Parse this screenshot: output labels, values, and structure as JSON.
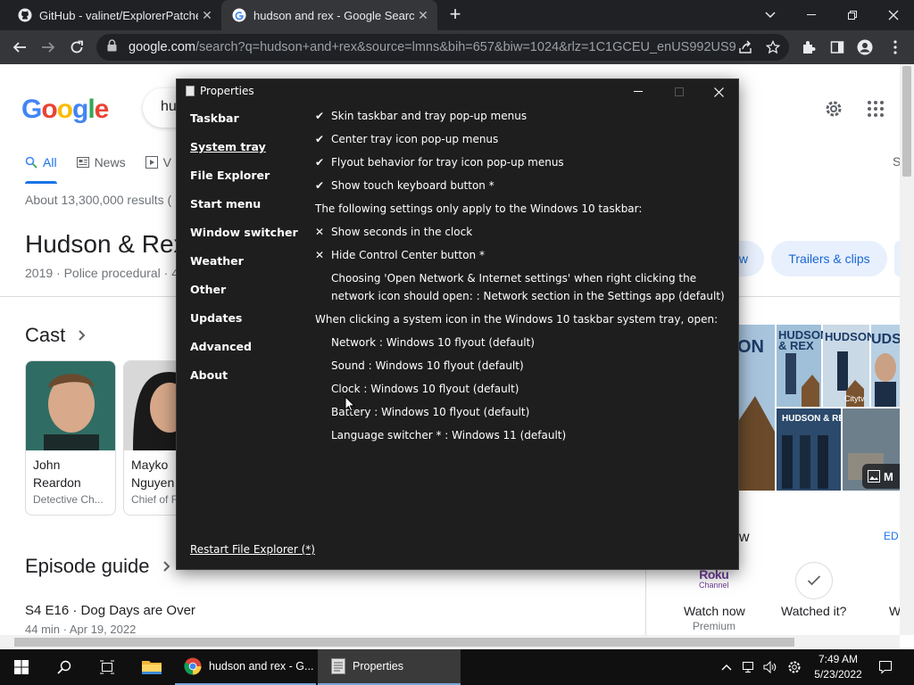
{
  "browser": {
    "tabs": [
      {
        "title": "GitHub - valinet/ExplorerPatcher",
        "close": "✕"
      },
      {
        "title": "hudson and rex - Google Search",
        "close": "✕"
      }
    ],
    "new_tab": "+",
    "address": {
      "domain": "google.com",
      "path": "/search?q=hudson+and+rex&source=lmns&bih=657&biw=1024&rlz=1C1GCEU_enUS992US9..."
    }
  },
  "google": {
    "logo": "Google",
    "search_text": "hu",
    "tabs": [
      {
        "label": "All"
      },
      {
        "label": "News"
      },
      {
        "label": "V"
      }
    ],
    "right_tab_fragment": "S",
    "results_count": "About 13,300,000 results (",
    "kp_title": "Hudson & Rex",
    "kp_subtitle": "2019 · Police procedural · 4",
    "chips": [
      "w",
      "Trailers & clips"
    ],
    "cast_heading": "Cast",
    "cast": [
      {
        "name": "John Reardon",
        "role": "Detective Ch..."
      },
      {
        "name": "Mayko Nguyen",
        "role": "Chief of F"
      }
    ],
    "poster_labels": [
      "ON",
      "HUDSON & REX",
      "HUDSON",
      "UDS",
      "Citytv",
      "HUDSON & REX",
      "M"
    ],
    "episode_heading": "Episode guide",
    "episode_title": "S4 E16 · Dog Days are Over",
    "episode_sub": "44 min · Apr 19, 2022",
    "watch_fragment": "w",
    "edit_fragment": "ED",
    "provider": {
      "name": "Roku",
      "sub": "Channel"
    },
    "watch_now": "Watch now",
    "watch_now_sub": "Premium",
    "watched_it": "Watched it?",
    "watch_more": "W"
  },
  "dialog": {
    "title": "Properties",
    "nav": [
      {
        "label": "Taskbar"
      },
      {
        "label": "System tray"
      },
      {
        "label": "File Explorer"
      },
      {
        "label": "Start menu"
      },
      {
        "label": "Window switcher"
      },
      {
        "label": "Weather"
      },
      {
        "label": "Other"
      },
      {
        "label": "Updates"
      },
      {
        "label": "Advanced"
      },
      {
        "label": "About"
      }
    ],
    "selected_nav": "System tray",
    "options": [
      {
        "mark": "✔",
        "text": "Skin taskbar and tray pop-up menus"
      },
      {
        "mark": "✔",
        "text": "Center tray icon pop-up menus"
      },
      {
        "mark": "✔",
        "text": "Flyout behavior for tray icon pop-up menus"
      },
      {
        "mark": "✔",
        "text": "Show touch keyboard button *"
      },
      {
        "mark": "",
        "text": "The following settings only apply to the Windows 10 taskbar:"
      },
      {
        "mark": "✕",
        "text": "Show seconds in the clock"
      },
      {
        "mark": "✕",
        "text": "Hide Control Center button *"
      },
      {
        "mark": "",
        "text": "Choosing 'Open Network & Internet settings' when right clicking the network icon should open: : Network section in the Settings app (default)"
      },
      {
        "mark": "",
        "text": "When clicking a system icon in the Windows 10 taskbar system tray, open:"
      },
      {
        "mark": "",
        "text": "Network : Windows 10 flyout (default)"
      },
      {
        "mark": "",
        "text": "Sound : Windows 10 flyout (default)"
      },
      {
        "mark": "",
        "text": "Clock : Windows 10 flyout (default)"
      },
      {
        "mark": "",
        "text": "Battery : Windows 10 flyout (default)"
      },
      {
        "mark": "",
        "text": "Language switcher * : Windows 11 (default)"
      }
    ],
    "restart_link": "Restart File Explorer (*)"
  },
  "taskbar": {
    "apps": [
      {
        "label": "hudson and rex - G..."
      },
      {
        "label": "Properties"
      }
    ],
    "time": "7:49 AM",
    "date": "5/23/2022"
  }
}
